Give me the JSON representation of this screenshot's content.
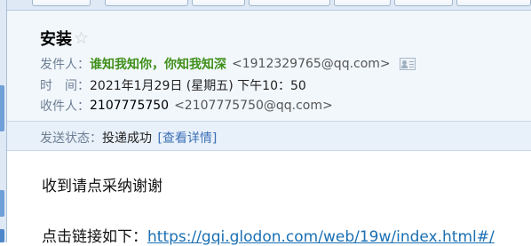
{
  "mail": {
    "subject": "安装",
    "from_label": "发件人：",
    "from_name": "谁知我知你，你知我知深",
    "from_address": "<1912329765@qq.com>",
    "time_label": "时　间：",
    "time_value": "2021年1月29日 (星期五) 下午10：50",
    "to_label": "收件人：",
    "to_name": "2107775750",
    "to_address": "<2107775750@qq.com>",
    "status_label": "发送状态：",
    "status_value": "投递成功",
    "details_link": "[查看详情]",
    "body_line1": "收到请点采纳谢谢",
    "body_line2_prefix": "点击链接如下：",
    "body_url": "https://gqi.glodon.com/web/19w/index.html#/"
  },
  "icons": {
    "star": "star-icon",
    "contact_card": "contact-card-icon"
  },
  "colors": {
    "header_bg": "#f2f7fc",
    "sender_name": "#3f8f1a",
    "link": "#1a6fb3",
    "status_bar_bg": "#e8f0f9"
  }
}
